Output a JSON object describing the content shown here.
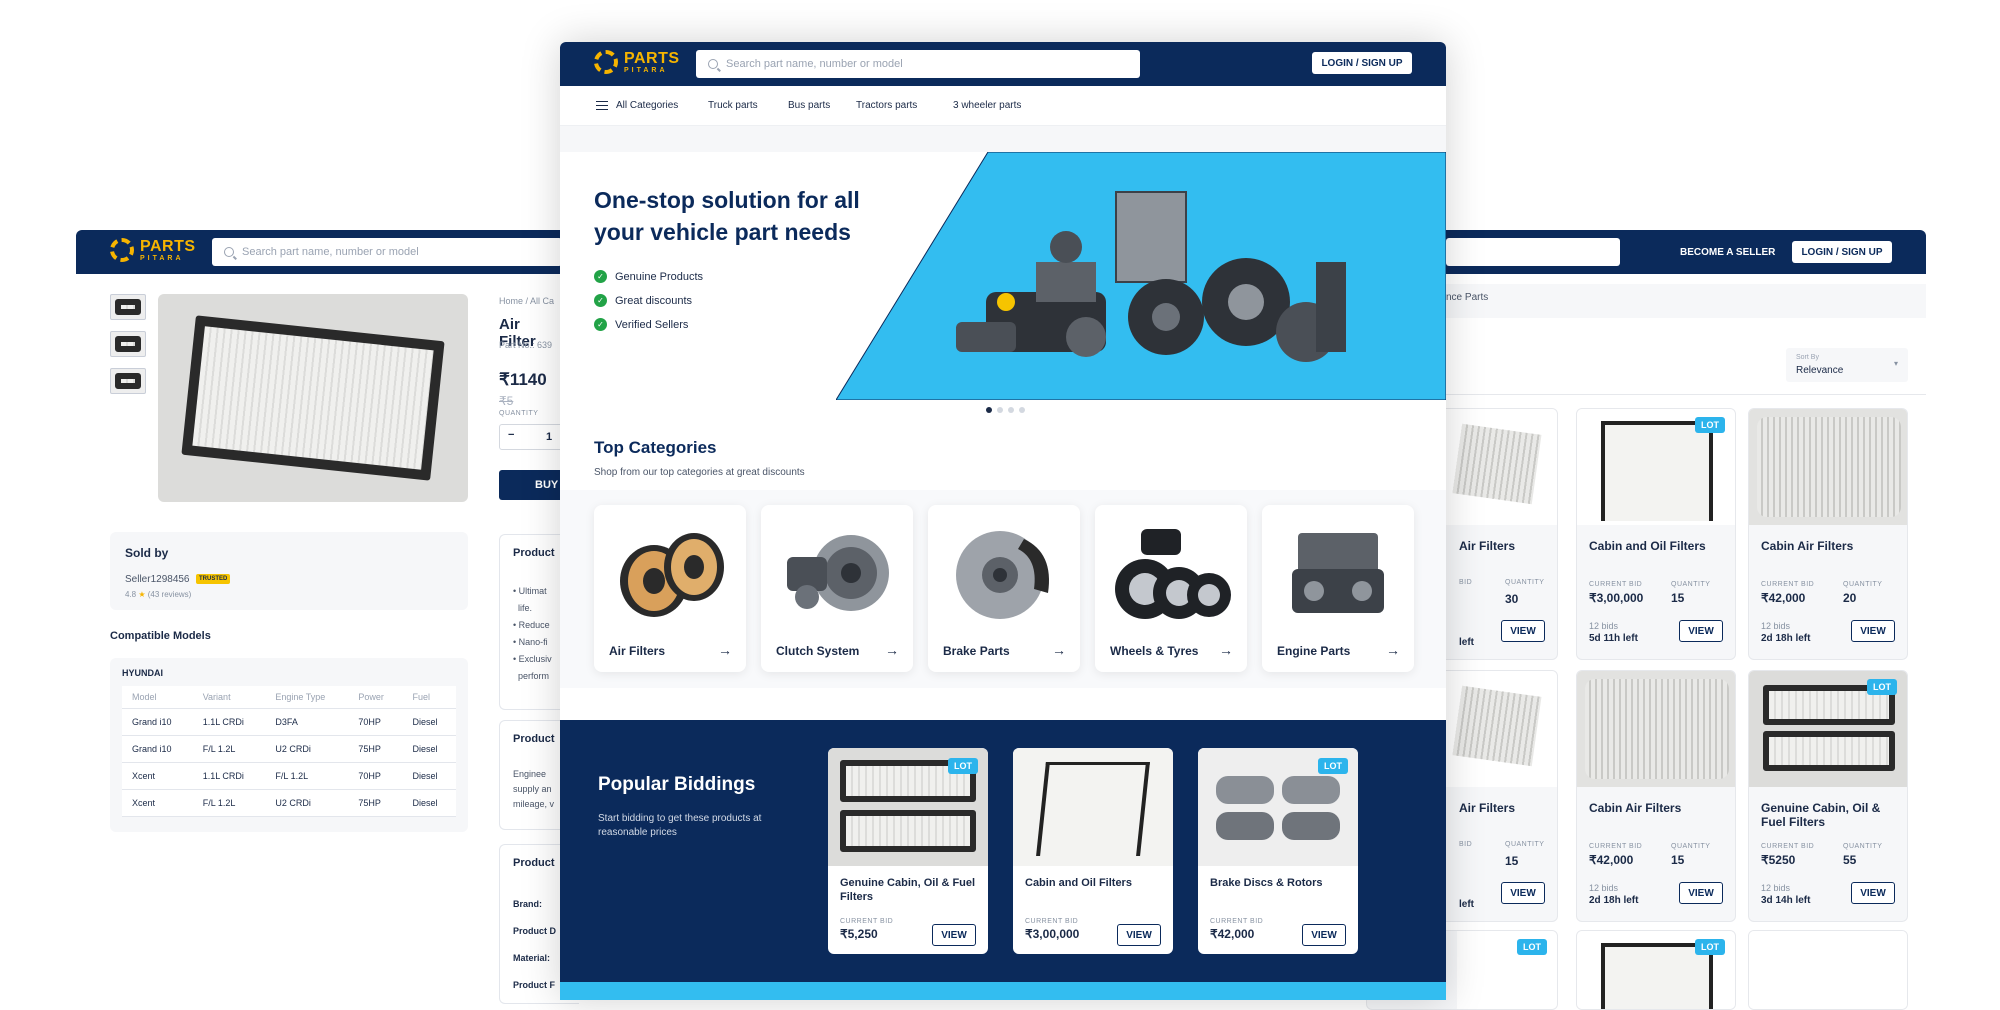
{
  "brand": {
    "name": "PARTS",
    "tagline": "PITARA"
  },
  "search": {
    "placeholder": "Search part name, number or model"
  },
  "header": {
    "login_label": "LOGIN / SIGN UP",
    "seller_label": "BECOME A SELLER"
  },
  "nav": {
    "items": [
      "All Categories",
      "Truck parts",
      "Bus parts",
      "Tractors parts",
      "3 wheeler parts"
    ]
  },
  "hero": {
    "title": "One-stop solution for all your vehicle part needs",
    "bullets": [
      "Genuine Products",
      "Great discounts",
      "Verified Sellers"
    ],
    "accent_color": "#33bdf0"
  },
  "top_categories": {
    "title": "Top Categories",
    "subtitle": "Shop from our top categories at great discounts",
    "items": [
      "Air Filters",
      "Clutch System",
      "Brake Parts",
      "Wheels & Tyres",
      "Engine Parts"
    ]
  },
  "popular": {
    "title": "Popular Biddings",
    "subtitle": "Start bidding to get these products at reasonable prices",
    "cards": [
      {
        "name": "Genuine Cabin, Oil & Fuel Filters",
        "bid_label": "CURRENT BID",
        "bid": "₹5,250",
        "badge": "LOT",
        "view": "VIEW"
      },
      {
        "name": "Cabin and Oil Filters",
        "bid_label": "CURRENT BID",
        "bid": "₹3,00,000",
        "view": "VIEW"
      },
      {
        "name": "Brake Discs & Rotors",
        "bid_label": "CURRENT BID",
        "bid": "₹42,000",
        "badge": "LOT",
        "view": "VIEW"
      }
    ]
  },
  "product": {
    "breadcrumb": [
      "Home",
      "All Ca"
    ],
    "title": "Air Filter",
    "part_no": "Part No.: 639",
    "price": "₹1140",
    "old_price": "₹5",
    "quantity_label": "QUANTITY",
    "quantity": "1",
    "buy_label": "BUY",
    "section1": "Product",
    "bullets": [
      "Ultimat",
      "life.",
      "Reduce",
      "Nano-fi",
      "Exclusiv",
      "perform"
    ],
    "section2": "Product",
    "desc_lines": [
      "Enginee",
      "supply an",
      "mileage, v"
    ],
    "section3": "Product",
    "specs": [
      "Brand:",
      "Product D",
      "Material:",
      "Product F"
    ]
  },
  "seller": {
    "title": "Sold by",
    "name": "Seller1298456",
    "badge": "TRUSTED",
    "rating": "4.8",
    "reviews": "(43 reviews)"
  },
  "compatible": {
    "title": "Compatible Models",
    "make": "HYUNDAI",
    "columns": [
      "Model",
      "Variant",
      "Engine Type",
      "Power",
      "Fuel"
    ],
    "rows": [
      [
        "Grand i10",
        "1.1L CRDi",
        "D3FA",
        "70HP",
        "Diesel"
      ],
      [
        "Grand i10",
        "F/L 1.2L",
        "U2 CRDi",
        "75HP",
        "Diesel"
      ],
      [
        "Xcent",
        "1.1L CRDi",
        "F/L 1.2L",
        "70HP",
        "Diesel"
      ],
      [
        "Xcent",
        "F/L 1.2L",
        "U2 CRDi",
        "75HP",
        "Diesel"
      ]
    ]
  },
  "listing": {
    "breadcrumb_tail": "nce Parts",
    "sort_label": "Sort By",
    "sort_value": "Relevance",
    "cards": [
      {
        "name": "Air Filters",
        "bid": "",
        "qty": "30",
        "bids": "",
        "time": "left",
        "view": "VIEW"
      },
      {
        "name": "Cabin and Oil Filters",
        "bid_label": "CURRENT BID",
        "bid": "₹3,00,000",
        "qty_label": "QUANTITY",
        "qty": "15",
        "bids": "12 bids",
        "time": "5d 11h left",
        "view": "VIEW",
        "badge": "LOT"
      },
      {
        "name": "Cabin Air Filters",
        "bid_label": "CURRENT BID",
        "bid": "₹42,000",
        "qty_label": "QUANTITY",
        "qty": "20",
        "bids": "12 bids",
        "time": "2d 18h left",
        "view": "VIEW"
      },
      {
        "name": "Air Filters",
        "bid": "",
        "qty": "15",
        "bids": "",
        "time": "left",
        "view": "VIEW"
      },
      {
        "name": "Cabin Air Filters",
        "bid_label": "CURRENT BID",
        "bid": "₹42,000",
        "qty_label": "QUANTITY",
        "qty": "15",
        "bids": "12 bids",
        "time": "2d 18h left",
        "view": "VIEW"
      },
      {
        "name": "Genuine Cabin, Oil & Fuel Filters",
        "bid_label": "CURRENT BID",
        "bid": "₹5250",
        "qty_label": "QUANTITY",
        "qty": "55",
        "bids": "12 bids",
        "time": "3d 14h left",
        "view": "VIEW",
        "badge": "LOT"
      }
    ],
    "bottom_badges": [
      "LOT",
      "LOT"
    ],
    "qty_label": "QUANTITY",
    "bid_label_partial": "BID"
  }
}
